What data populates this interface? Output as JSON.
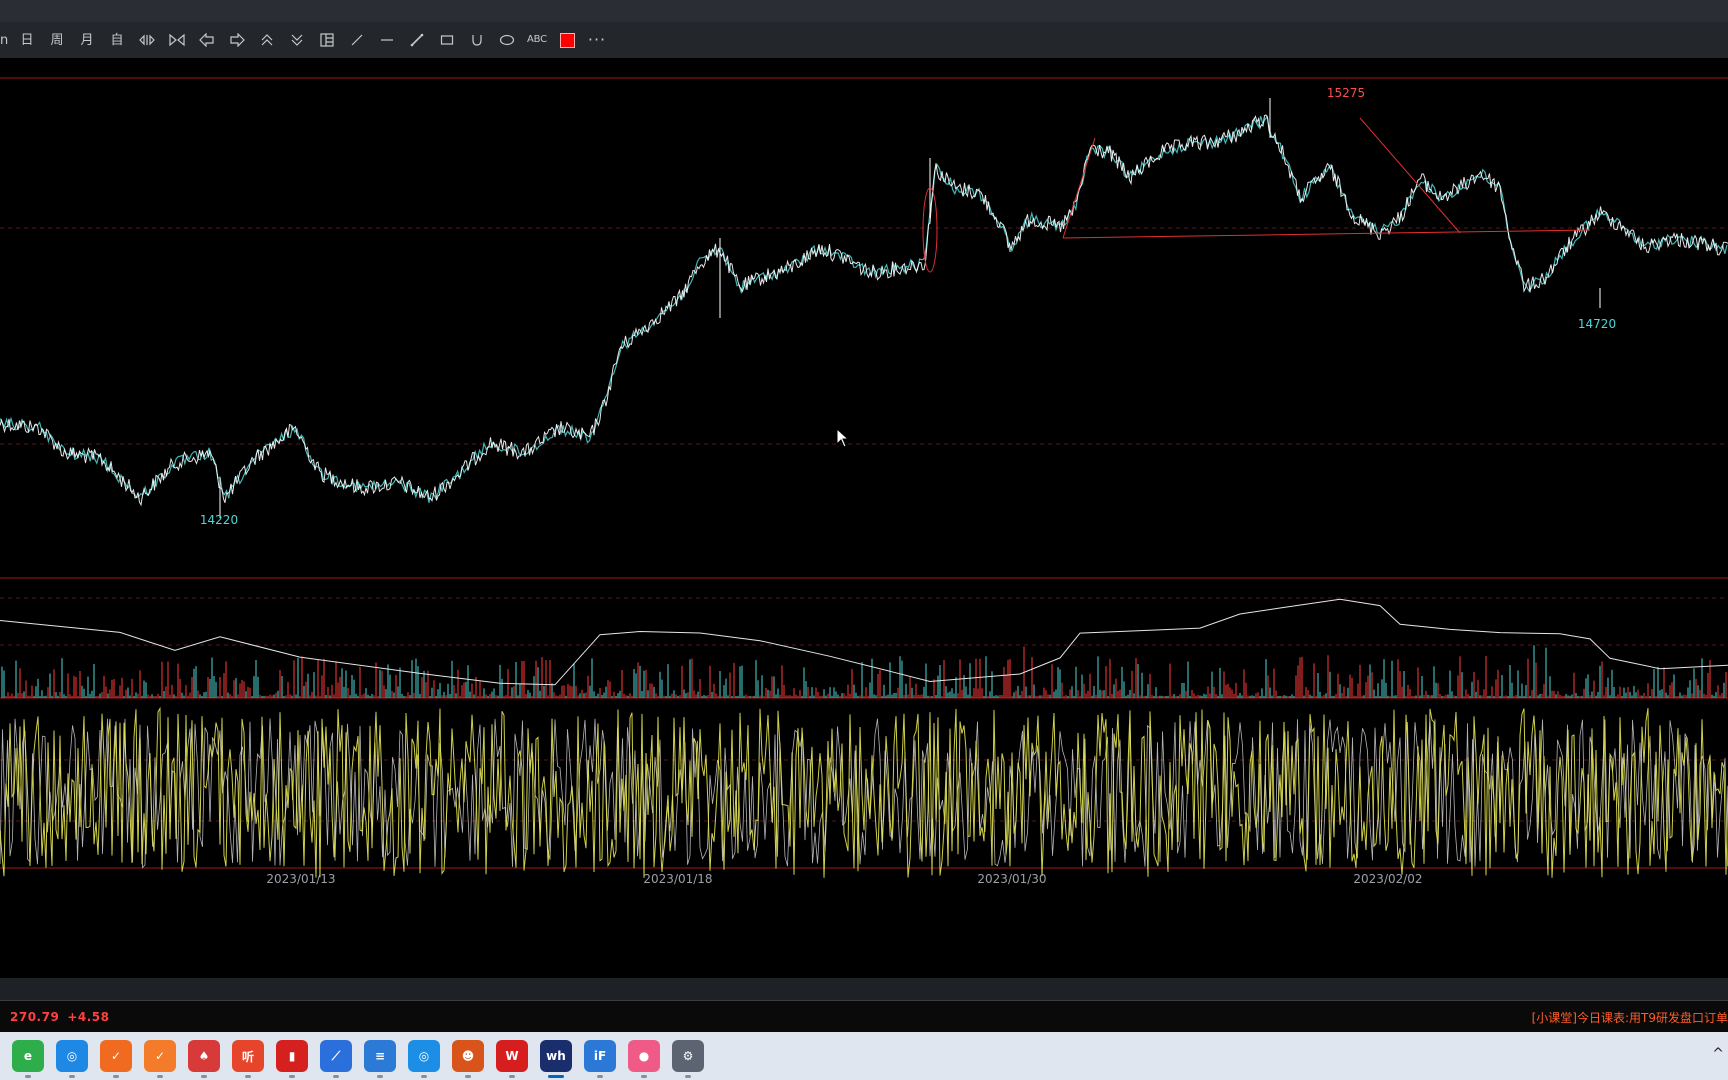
{
  "toolbar": {
    "items": [
      {
        "name": "tool-partial",
        "label": "n"
      },
      {
        "name": "tool-day",
        "label": "日"
      },
      {
        "name": "tool-week",
        "label": "周"
      },
      {
        "name": "tool-month",
        "label": "月"
      },
      {
        "name": "tool-custom",
        "label": "自"
      },
      {
        "name": "tool-zoom-in",
        "icon": "zoom-in-icon"
      },
      {
        "name": "tool-zoom-out",
        "icon": "zoom-out-icon"
      },
      {
        "name": "tool-left",
        "icon": "arrow-left-icon"
      },
      {
        "name": "tool-right",
        "icon": "arrow-right-icon"
      },
      {
        "name": "tool-up",
        "icon": "chevron-double-up-icon"
      },
      {
        "name": "tool-down",
        "icon": "chevron-double-down-icon"
      },
      {
        "name": "tool-layout",
        "icon": "layout-icon"
      },
      {
        "name": "tool-line",
        "icon": "draw-line-icon"
      },
      {
        "name": "tool-hline",
        "icon": "horizontal-line-icon"
      },
      {
        "name": "tool-ray",
        "icon": "ray-line-icon"
      },
      {
        "name": "tool-rect",
        "icon": "rectangle-icon"
      },
      {
        "name": "tool-arc",
        "icon": "arc-icon"
      },
      {
        "name": "tool-ellipse",
        "icon": "ellipse-icon"
      },
      {
        "name": "tool-text",
        "label": "ABC"
      },
      {
        "name": "tool-color",
        "icon": "color-swatch-icon",
        "color": "#ff0000"
      },
      {
        "name": "tool-more",
        "label": "···"
      }
    ]
  },
  "chart": {
    "high_label": "15275",
    "low_label_left": "14220",
    "low_label_right": "14720",
    "date_labels": [
      "2023/01/13",
      "2023/01/18",
      "2023/01/30",
      "2023/02/02"
    ],
    "colors": {
      "price_line": "#ffffff",
      "price_accent": "#4fd6d6",
      "drawing_red": "#e03030",
      "grid_red": "#7a1a1a",
      "volume_up": "#ff3b3b",
      "volume_down": "#4fd6d6",
      "oscillator": "#e6e650",
      "high_label_color": "#ff4c4c",
      "low_label_color": "#4fd6d6"
    }
  },
  "status": {
    "left_value": "270.79",
    "left_change": "+4.58",
    "right_notice": "[小课堂]今日课表:用T9研发盘口订单"
  },
  "taskbar": {
    "apps": [
      {
        "name": "edge-like-icon",
        "color": "#2eae4b",
        "glyph": "e"
      },
      {
        "name": "browser-icon",
        "color": "#1e88e5",
        "glyph": "◎"
      },
      {
        "name": "orange-app-icon",
        "color": "#f06a1f",
        "glyph": "✓"
      },
      {
        "name": "orange-app2-icon",
        "color": "#f37b2a",
        "glyph": "✓"
      },
      {
        "name": "poker-icon",
        "color": "#d83a3a",
        "glyph": "♠"
      },
      {
        "name": "listen-icon",
        "color": "#e7452b",
        "glyph": "听"
      },
      {
        "name": "stock-red-icon",
        "color": "#d62020",
        "glyph": "▮"
      },
      {
        "name": "stock-chart-icon",
        "color": "#2a6fdb",
        "glyph": "⟋"
      },
      {
        "name": "notepad-icon",
        "color": "#2a7ad6",
        "glyph": "≡"
      },
      {
        "name": "cloud-icon",
        "color": "#1c8ee6",
        "glyph": "◎"
      },
      {
        "name": "game-icon",
        "color": "#d8541a",
        "glyph": "☻"
      },
      {
        "name": "wps-icon",
        "color": "#d61e1e",
        "glyph": "W"
      },
      {
        "name": "wh6-icon",
        "color": "#1a2e6e",
        "glyph": "wh"
      },
      {
        "name": "ifly-icon",
        "color": "#2b78d6",
        "glyph": "iF"
      },
      {
        "name": "bag-icon",
        "color": "#f05a86",
        "glyph": "●"
      },
      {
        "name": "settings-icon",
        "color": "#5b6470",
        "glyph": "⚙"
      }
    ],
    "tray_chevron": "^"
  }
}
